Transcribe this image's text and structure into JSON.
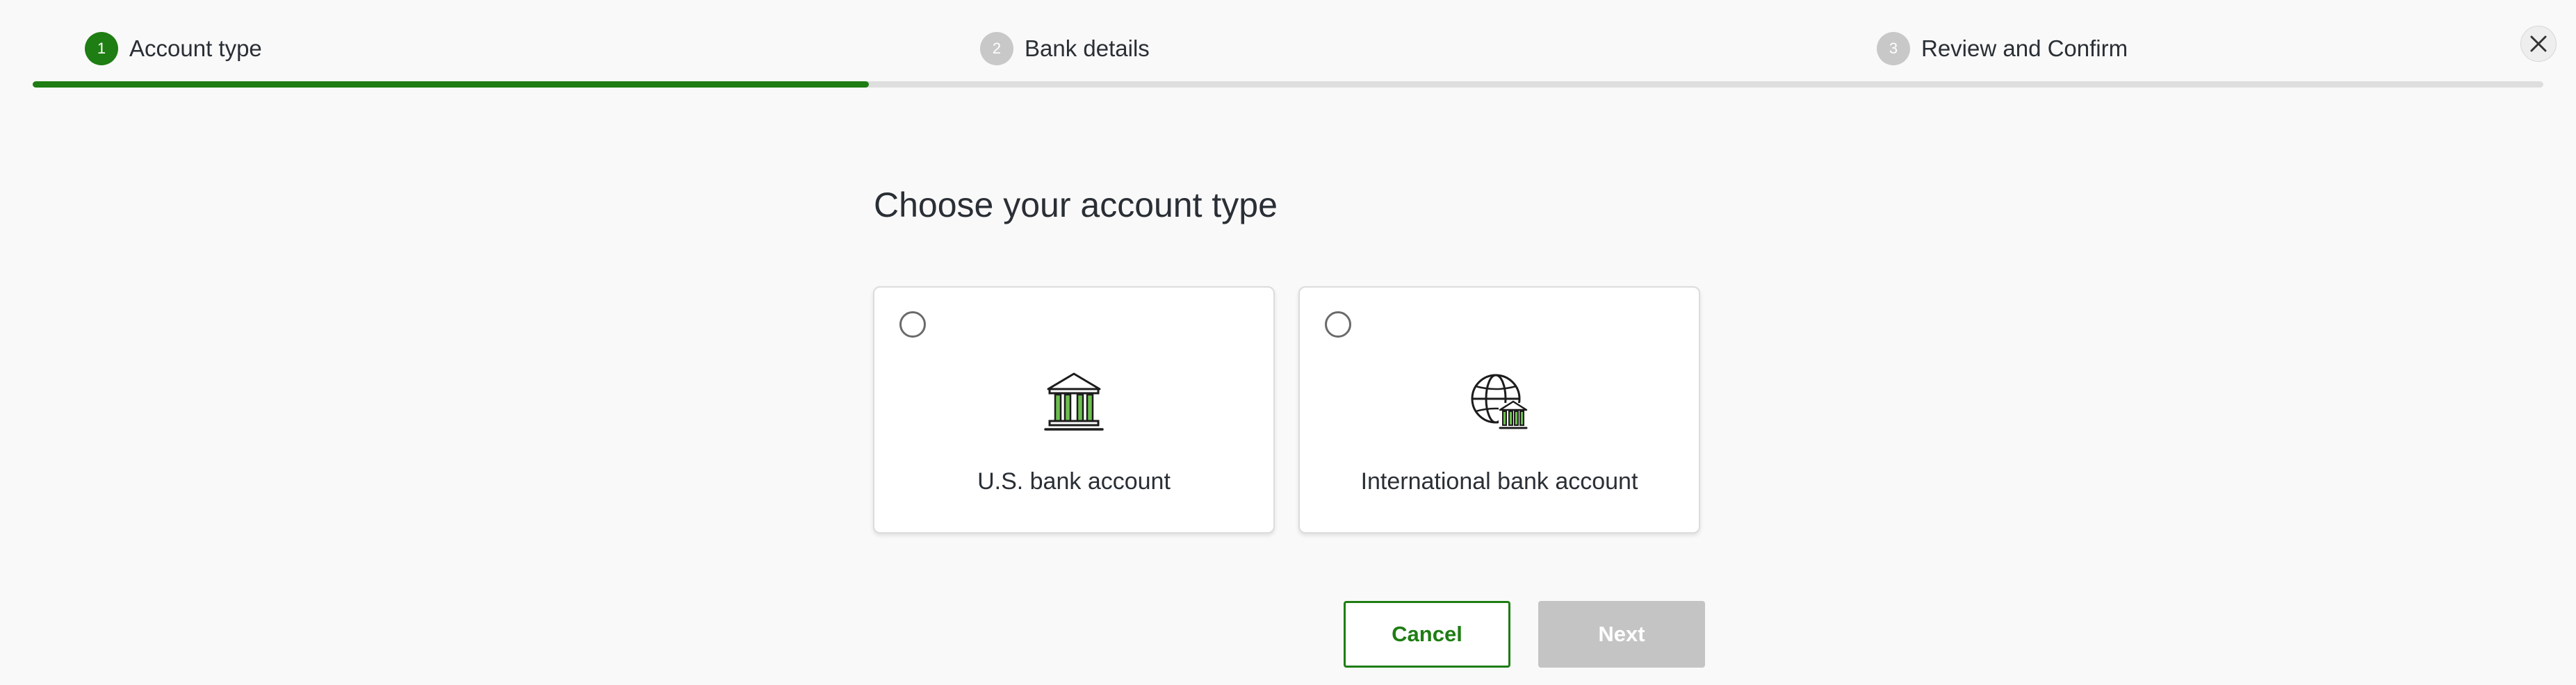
{
  "stepper": {
    "steps": [
      {
        "number": "1",
        "label": "Account type"
      },
      {
        "number": "2",
        "label": "Bank details"
      },
      {
        "number": "3",
        "label": "Review and Confirm"
      }
    ],
    "progress_fraction": 0.333
  },
  "close": {
    "icon": "close-icon"
  },
  "main": {
    "heading": "Choose your account type",
    "options": [
      {
        "label": "U.S. bank account",
        "icon": "bank-building-icon",
        "selected": false
      },
      {
        "label": "International bank account",
        "icon": "globe-bank-icon",
        "selected": false
      }
    ],
    "actions": {
      "cancel_label": "Cancel",
      "next_label": "Next"
    }
  },
  "colors": {
    "accent": "#1e7d13",
    "disabled": "#c4c4c4",
    "background": "#f9f9f9"
  }
}
